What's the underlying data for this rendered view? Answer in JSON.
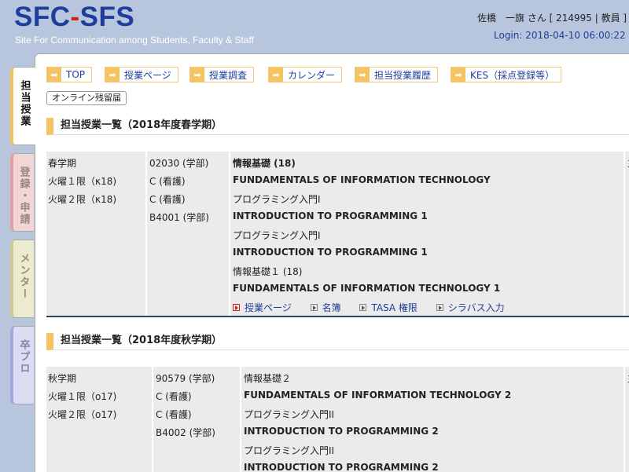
{
  "header": {
    "logo_left": "SFC",
    "logo_dash": "-",
    "logo_right": "SFS",
    "tagline": "Site For Communication among Students, Faculty & Staff",
    "user": "佐橋　一旗 さん [ 214995 | 教員 ]",
    "login": "Login: 2018-04-10 06:00:22"
  },
  "sidetabs": {
    "tanto": "担当授業",
    "toroku": "登録・申請",
    "mentor": "メンター",
    "sotsu": "卒プロ"
  },
  "nav": {
    "items": [
      "TOP",
      "授業ページ",
      "授業調査",
      "カレンダー",
      "担当授業履歴",
      "KES（採点登録等）"
    ],
    "online": "オンライン残留届"
  },
  "spring": {
    "heading": "担当授業一覧（2018年度春学期）",
    "col1": [
      "春学期",
      "火曜１限（κ18)",
      "火曜２限（κ18)"
    ],
    "col2": [
      "02030 (学部)",
      "C (看護)",
      "C (看護)",
      "B4001 (学部)"
    ],
    "col3": [
      "情報基礎 (18)",
      "FUNDAMENTALS OF INFORMATION TECHNOLOGY",
      "プログラミング入門I",
      "INTRODUCTION TO PROGRAMMING 1",
      "プログラミング入門I",
      "INTRODUCTION TO PROGRAMMING 1",
      "情報基礎１ (18)",
      "FUNDAMENTALS OF INFORMATION TECHNOLOGY 1"
    ],
    "links": [
      "授業ページ",
      "名簿",
      "TASA 権限",
      "シラバス入力"
    ],
    "col4": "主"
  },
  "autumn": {
    "heading": "担当授業一覧（2018年度秋学期）",
    "col1": [
      "秋学期",
      "火曜１限（o17)",
      "火曜２限（o17)"
    ],
    "col2": [
      "90579 (学部)",
      "C (看護)",
      "C (看護)",
      "B4002 (学部)"
    ],
    "col3": [
      "情報基礎２",
      "FUNDAMENTALS OF INFORMATION TECHNOLOGY 2",
      "プログラミング入門II",
      "INTRODUCTION TO PROGRAMMING 2",
      "プログラミング入門II",
      "INTRODUCTION TO PROGRAMMING 2"
    ],
    "col4": "主"
  }
}
